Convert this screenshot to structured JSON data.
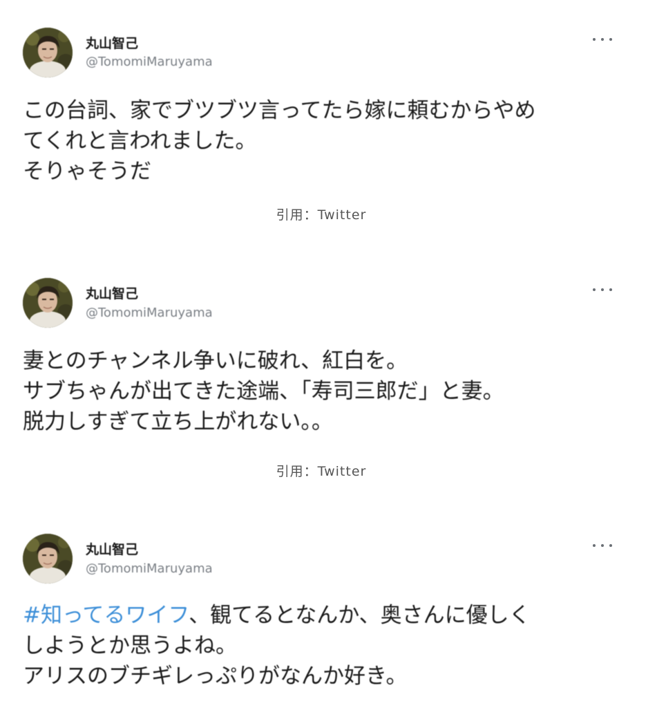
{
  "tweets": [
    {
      "name": "丸山智己",
      "handle": "@TomomiMaruyama",
      "lines": [
        "この台詞、家でブツブツ言ってたら嫁に頼むからやめ",
        "てくれと言われました。",
        "そりゃそうだ"
      ],
      "citation": "引用：Twitter"
    },
    {
      "name": "丸山智己",
      "handle": "@TomomiMaruyama",
      "lines": [
        "妻とのチャンネル争いに破れ、紅白を。",
        "サブちゃんが出てきた途端、「寿司三郎だ」と妻。",
        "脱力しすぎて立ち上がれない。。"
      ],
      "citation": "引用：Twitter"
    },
    {
      "name": "丸山智己",
      "handle": "@TomomiMaruyama",
      "hashtag": "#知ってるワイフ",
      "first_line_rest": "、観てるとなんか、奥さんに優しく",
      "lines": [
        "しようとか思うよね。",
        "アリスのブチギレっぷりがなんか好き。"
      ]
    }
  ],
  "colors": {
    "hashtag": "#3d8fd8",
    "handle": "#7a7f85",
    "text": "#1b1b1b"
  },
  "icons": {
    "more": "more-horizontal-icon",
    "avatar": "profile-photo"
  }
}
